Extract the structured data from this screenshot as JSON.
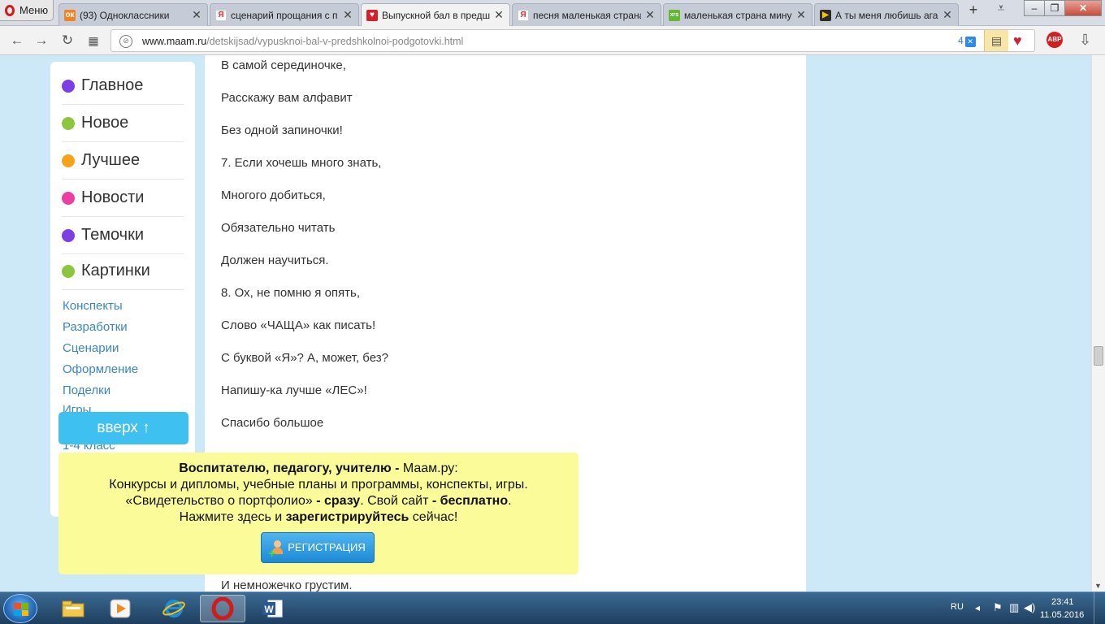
{
  "browser": {
    "menu_label": "Меню",
    "tabs": [
      {
        "title": "(93) Одноклассники",
        "icon": "odnoklassniki-icon",
        "color": "#f58220",
        "glyph": "ок"
      },
      {
        "title": "сценарий прощания с п",
        "icon": "yandex-icon",
        "color": "#ffffff",
        "glyph": "Я"
      },
      {
        "title": "Выпускной бал в предш",
        "icon": "maam-heart-icon",
        "color": "#d2232a",
        "glyph": "♥"
      },
      {
        "title": "песня маленькая страна",
        "icon": "yandex-icon",
        "color": "#ffffff",
        "glyph": "Я"
      },
      {
        "title": "маленькая страна мину",
        "icon": "site-icon",
        "color": "#63b832",
        "glyph": "xrs"
      },
      {
        "title": "А ты меня любишь ага",
        "icon": "play-icon",
        "color": "#2b2b2b",
        "glyph": "▶"
      }
    ],
    "url_host": "www.maam.ru",
    "url_path": "/detskijsad/vypusknoi-bal-v-predshkolnoi-podgotovki.html",
    "blocked_count": "4"
  },
  "sidebar": {
    "main_items": [
      {
        "label": "Главное",
        "color": "#7b3fe4"
      },
      {
        "label": "Новое",
        "color": "#8cc63f"
      },
      {
        "label": "Лучшее",
        "color": "#f7a21b"
      },
      {
        "label": "Новости",
        "color": "#ec3fa6"
      },
      {
        "label": "Темочки",
        "color": "#7b3fe4"
      },
      {
        "label": "Картинки",
        "color": "#8cc63f"
      }
    ],
    "links": [
      "Конспекты",
      "Разработки",
      "Сценарии",
      "Оформление",
      "Поделки",
      "Игры",
      "1-4 класс"
    ],
    "scroll_top_label": "вверх ↑"
  },
  "article": {
    "lines": [
      "В самой серединочке,",
      "Расскажу вам алфавит",
      "Без одной запиночки!",
      "7. Если хочешь много знать,",
      "Многого добиться,",
      "Обязательно читать",
      "Должен научиться.",
      "8. Ох, не помню я опять,",
      "Слово «ЧАЩА» как писать!",
      "С буквой «Я»? А, может, без?",
      "Напишу-ка лучше «ЛЕС»!",
      "Спасибо большое"
    ],
    "bottom_line": "И немножечко грустим."
  },
  "promo": {
    "l1_bold": "Воспитателю, педагогу, учителю -",
    "l1_rest": " Маам.ру:",
    "l2": "Конкурсы и дипломы, учебные планы и программы, конспекты, игры.",
    "l3_a": "«Свидетельство о портфолио»",
    "l3_b": " - сразу",
    "l3_c": ". Свой сайт ",
    "l3_d": "- бесплатно",
    "l3_e": ".",
    "l4_a": "Нажмите здесь и ",
    "l4_b": "зарегистрируйтесь",
    "l4_c": " сейчас!",
    "button_label": "РЕГИСТРАЦИЯ"
  },
  "taskbar": {
    "apps": [
      "file-explorer-icon",
      "media-player-icon",
      "internet-explorer-icon",
      "opera-icon",
      "word-icon"
    ],
    "language": "RU",
    "time": "23:41",
    "date": "11.05.2016"
  }
}
